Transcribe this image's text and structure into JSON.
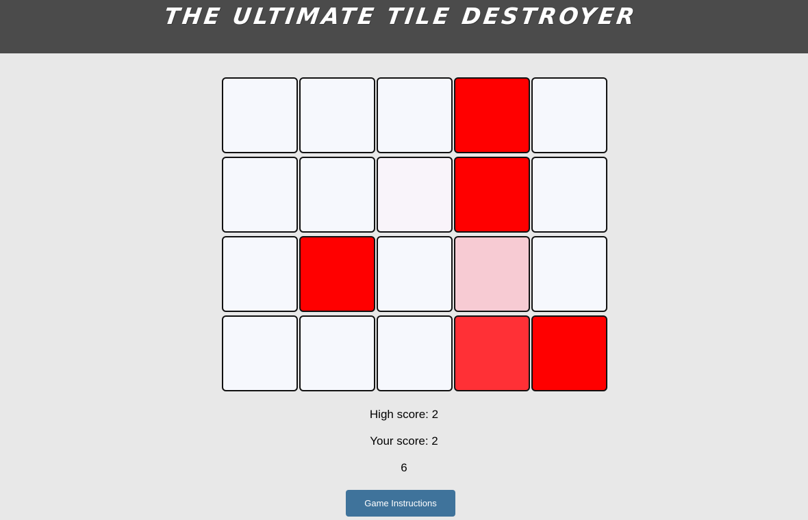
{
  "header": {
    "title": "THE ULTIMATE TILE DESTROYER",
    "background": "#4b4b4b"
  },
  "board": {
    "rows": 4,
    "columns": 5,
    "tiles": [
      [
        "#f6f8fd",
        "#f6f8fd",
        "#f6f8fd",
        "#ff0000",
        "#f6f8fd"
      ],
      [
        "#f6f8fd",
        "#f6f8fd",
        "#f9f4fa",
        "#ff0000",
        "#f6f8fd"
      ],
      [
        "#f6f8fd",
        "#ff0000",
        "#f6f8fd",
        "#f7cbd3",
        "#f6f8fd"
      ],
      [
        "#f6f8fd",
        "#f6f8fd",
        "#f6f8fd",
        "#ff3036",
        "#ff0000"
      ]
    ]
  },
  "scores": {
    "high_score": "High score: 2",
    "your_score": "Your score: 2",
    "counter": "6"
  },
  "instructions_button": {
    "label": "Game Instructions",
    "color": "#3f739b"
  }
}
